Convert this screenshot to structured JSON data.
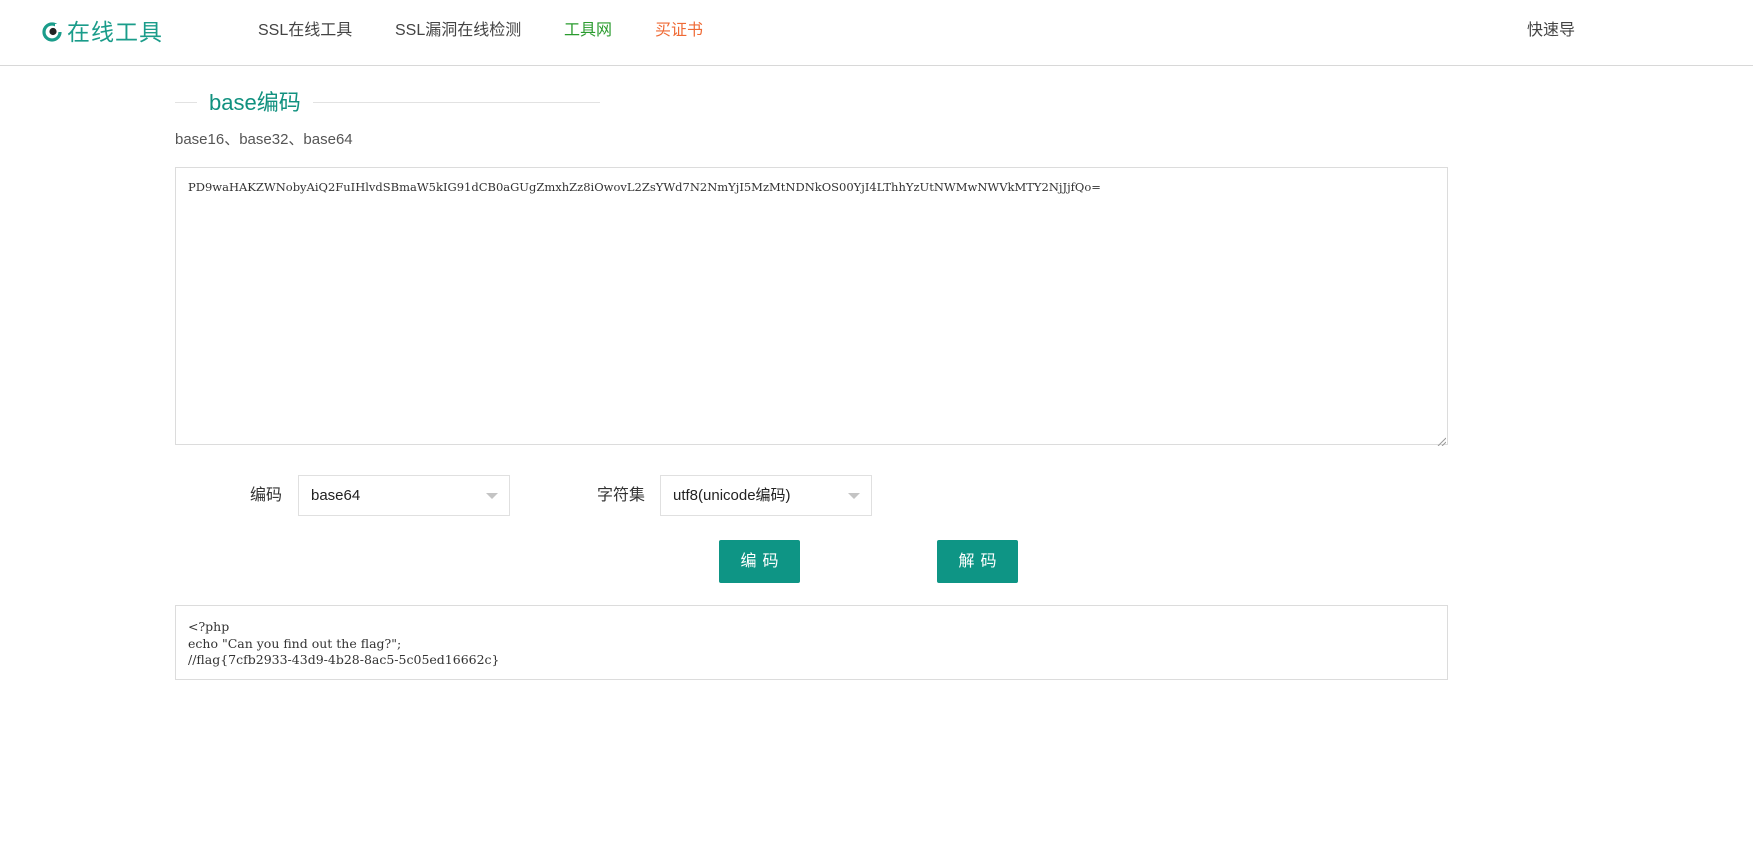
{
  "header": {
    "logo_text": "在线工具",
    "nav": [
      {
        "label": "SSL在线工具"
      },
      {
        "label": "SSL漏洞在线检测"
      },
      {
        "label": "工具网"
      },
      {
        "label": "买证书"
      },
      {
        "label": "快速导"
      }
    ],
    "colors": {
      "brand": "#1a9c8a",
      "nav_green": "#2a9b2e",
      "nav_orange": "#ef6a35"
    }
  },
  "main": {
    "title": "base编码",
    "subtitle": "base16、base32、base64",
    "input_value": "PD9waHAKZWNobyAiQ2FuIHlvdSBmaW5kIG91dCB0aGUgZmxhZz8iOwovL2ZsYWd7N2NmYjI5MzMtNDNkOS00YjI4LThhYzUtNWMwNWVkMTY2NjJjfQo=",
    "encoding_label": "编码",
    "encoding_value": "base64",
    "charset_label": "字符集",
    "charset_value": "utf8(unicode编码)",
    "encode_button": "编码",
    "decode_button": "解码",
    "output_lines": [
      "<?php",
      "echo \"Can you find out the flag?\";",
      "//flag{7cfb2933-43d9-4b28-8ac5-5c05ed16662c}"
    ],
    "accent_color": "#0e9585"
  }
}
